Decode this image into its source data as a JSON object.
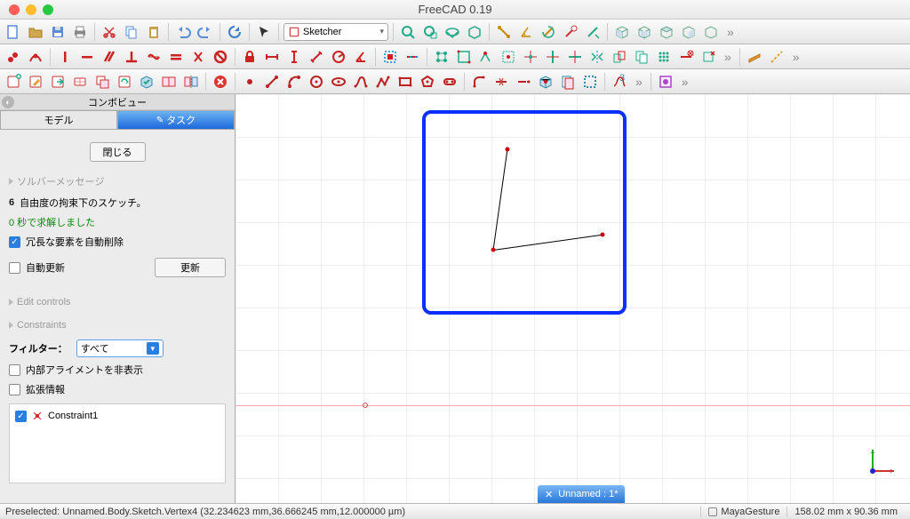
{
  "app_title": "FreeCAD 0.19",
  "workbench": {
    "selected": "Sketcher"
  },
  "panel": {
    "header": "コンボビュー",
    "tabs": {
      "model": "モデル",
      "task": "タスク"
    },
    "close_btn": "閉じる",
    "sect_solver": "ソルバーメッセージ",
    "dof_prefix": "6",
    "dof_text": " 自由度の拘束下のスケッチ。",
    "solved": "0 秒で求解しました",
    "auto_delete": "冗長な要素を自動削除",
    "auto_update": "自動更新",
    "update_btn": "更新",
    "sect_edit": "Edit controls",
    "sect_constraints": "Constraints",
    "filter_label": "フィルター：",
    "filter_value": "すべて",
    "hide_internal": "内部アライメントを非表示",
    "ext_info": "拡張情報",
    "constraint_item": "Constraint1"
  },
  "doc_tab": {
    "close": "✕",
    "name": "Unnamed : 1*"
  },
  "status": {
    "preselect": "Preselected: Unnamed.Body.Sketch.Vertex4 (32.234623 mm,36.666245 mm,12.000000 µm)",
    "nav": "MayaGesture",
    "dim": "158.02 mm x 90.36 mm"
  }
}
